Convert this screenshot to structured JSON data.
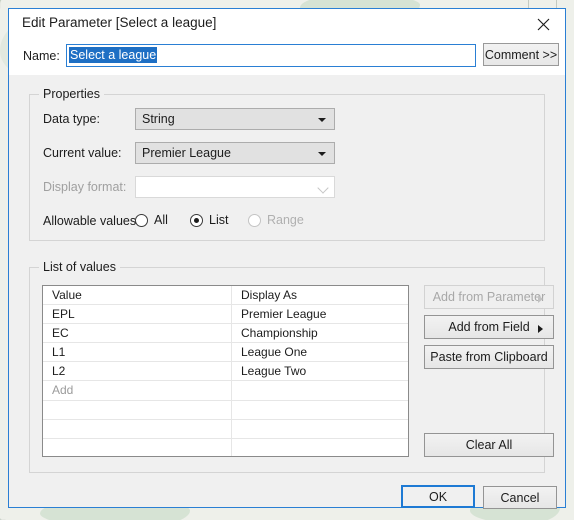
{
  "window": {
    "title": "Edit Parameter [Select a league]",
    "close_icon": "close-icon"
  },
  "name_row": {
    "label": "Name:",
    "value": "Select a league",
    "placeholder": "",
    "comment_button": "Comment >>"
  },
  "properties": {
    "legend": "Properties",
    "data_type": {
      "label": "Data type:",
      "value": "String"
    },
    "current_value": {
      "label": "Current value:",
      "value": "Premier League"
    },
    "display_format": {
      "label": "Display format:",
      "value": ""
    },
    "allowable_values": {
      "label": "Allowable values:",
      "options": [
        {
          "label": "All",
          "selected": false,
          "disabled": false
        },
        {
          "label": "List",
          "selected": true,
          "disabled": false
        },
        {
          "label": "Range",
          "selected": false,
          "disabled": true
        }
      ]
    }
  },
  "list_of_values": {
    "legend": "List of values",
    "columns": [
      "Value",
      "Display As"
    ],
    "rows": [
      {
        "value": "Value",
        "display_as": "Display As",
        "placeholder": false
      },
      {
        "value": "EPL",
        "display_as": "Premier League",
        "placeholder": false
      },
      {
        "value": "EC",
        "display_as": "Championship",
        "placeholder": false
      },
      {
        "value": "L1",
        "display_as": "League One",
        "placeholder": false
      },
      {
        "value": "L2",
        "display_as": "League Two",
        "placeholder": false
      },
      {
        "value": "Add",
        "display_as": "",
        "placeholder": true
      },
      {
        "value": "",
        "display_as": "",
        "placeholder": false
      },
      {
        "value": "",
        "display_as": "",
        "placeholder": false
      },
      {
        "value": "",
        "display_as": "",
        "placeholder": false
      },
      {
        "value": "",
        "display_as": "",
        "placeholder": false
      }
    ],
    "buttons": {
      "add_from_parameter": {
        "label": "Add from Parameter",
        "disabled": true,
        "has_arrow": true
      },
      "add_from_field": {
        "label": "Add from Field",
        "disabled": false,
        "has_arrow": true
      },
      "paste_from_clipboard": {
        "label": "Paste from Clipboard",
        "disabled": false,
        "has_arrow": false
      },
      "clear_all": {
        "label": "Clear All",
        "disabled": false,
        "has_arrow": false
      }
    }
  },
  "footer": {
    "ok": "OK",
    "cancel": "Cancel"
  },
  "colors": {
    "accent": "#1e7ad4",
    "window_border": "#2a7fd4",
    "selection": "#1e6fc4",
    "dialog_bg": "#f0f0f0",
    "field_bg": "#e1e1e1",
    "disabled_text": "#a8a8a8"
  }
}
